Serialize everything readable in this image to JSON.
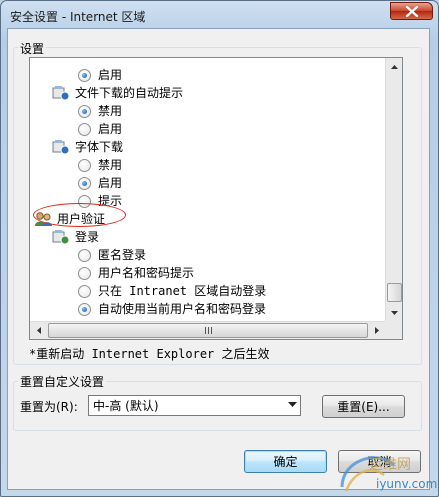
{
  "window": {
    "title": "安全设置 - Internet 区域"
  },
  "settings_group": {
    "label": "设置"
  },
  "tree": {
    "rows": [
      {
        "type": "radio",
        "checked": true,
        "label": "启用"
      },
      {
        "type": "folder",
        "label": "文件下载的自动提示"
      },
      {
        "type": "radio",
        "checked": true,
        "label": "禁用"
      },
      {
        "type": "radio",
        "checked": false,
        "label": "启用"
      },
      {
        "type": "folder",
        "label": "字体下载"
      },
      {
        "type": "radio",
        "checked": false,
        "label": "禁用"
      },
      {
        "type": "radio",
        "checked": true,
        "label": "启用"
      },
      {
        "type": "radio",
        "checked": false,
        "label": "提示"
      },
      {
        "type": "folder-user",
        "label": "用户验证"
      },
      {
        "type": "folder-sub",
        "label": "登录"
      },
      {
        "type": "radio",
        "checked": false,
        "label": "匿名登录"
      },
      {
        "type": "radio",
        "checked": false,
        "label": "用户名和密码提示"
      },
      {
        "type": "radio",
        "checked": false,
        "label": "只在 Intranet 区域自动登录"
      },
      {
        "type": "radio",
        "checked": true,
        "label": "自动使用当前用户名和密码登录"
      }
    ]
  },
  "restart_note": "*重新启动 Internet Explorer 之后生效",
  "custom_group": {
    "label": "重置自定义设置",
    "reset_to_label": "重置为(R):",
    "select_value": "中-高 (默认)",
    "reset_button": "重置(E)..."
  },
  "dialog_buttons": {
    "ok": "确定",
    "cancel": "取消"
  },
  "watermark": {
    "text": "运维网",
    "url": "iyunv.com"
  },
  "colors": {
    "annotation": "#e0281a",
    "window_frame": "#bcd3ea"
  }
}
